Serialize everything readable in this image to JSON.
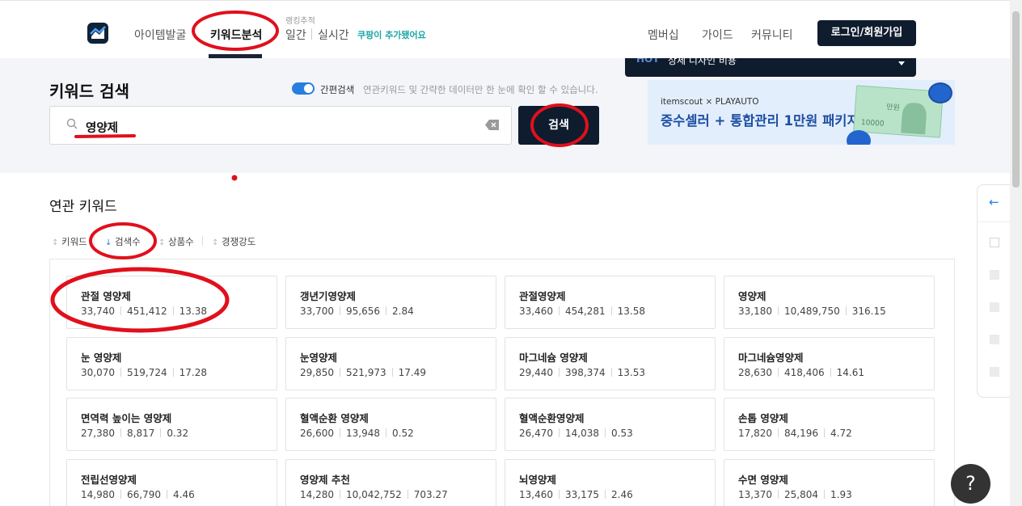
{
  "nav": {
    "items": [
      "아이템발굴",
      "키워드분석"
    ],
    "ranking_label": "랭킹추적",
    "daily": "일간",
    "realtime": "실시간",
    "coupang_badge": "쿠팡이 추가됐어요",
    "right_items": [
      "멤버십",
      "가이드",
      "커뮤니티"
    ],
    "login": "로그인/회원가입"
  },
  "hot": {
    "label": "HOT",
    "text": "상세 디자인 비용"
  },
  "search": {
    "title": "키워드 검색",
    "toggle_label": "간편검색",
    "toggle_desc": "연관키워드 및 간략한 데이터만 한 눈에 확인 할 수 있습니다.",
    "query": "영양제",
    "button": "검색"
  },
  "banner": {
    "brand": "itemscout × PLAYAUTO",
    "text": "중수셀러 + 통합관리 1만원 패키지",
    "money_amount": "만원",
    "money_number": "10000"
  },
  "related": {
    "title": "연관 키워드",
    "sort": [
      {
        "label": "키워드",
        "icon": "sort-both-icon",
        "active": false
      },
      {
        "label": "검색수",
        "icon": "sort-desc-icon",
        "active": true
      },
      {
        "label": "상품수",
        "icon": "sort-both-icon",
        "active": false
      },
      {
        "label": "경쟁강도",
        "icon": "sort-both-icon",
        "active": false
      }
    ],
    "cards": [
      {
        "name": "관절 영양제",
        "searches": "33,740",
        "products": "451,412",
        "competition": "13.38"
      },
      {
        "name": "갱년기영양제",
        "searches": "33,700",
        "products": "95,656",
        "competition": "2.84"
      },
      {
        "name": "관절영양제",
        "searches": "33,460",
        "products": "454,281",
        "competition": "13.58"
      },
      {
        "name": "영양제",
        "searches": "33,180",
        "products": "10,489,750",
        "competition": "316.15"
      },
      {
        "name": "눈 영양제",
        "searches": "30,070",
        "products": "519,724",
        "competition": "17.28"
      },
      {
        "name": "눈영양제",
        "searches": "29,850",
        "products": "521,973",
        "competition": "17.49"
      },
      {
        "name": "마그네슘 영양제",
        "searches": "29,440",
        "products": "398,374",
        "competition": "13.53"
      },
      {
        "name": "마그네슘영양제",
        "searches": "28,630",
        "products": "418,406",
        "competition": "14.61"
      },
      {
        "name": "면역력 높이는 영양제",
        "searches": "27,380",
        "products": "8,817",
        "competition": "0.32"
      },
      {
        "name": "혈액순환 영양제",
        "searches": "26,600",
        "products": "13,948",
        "competition": "0.52"
      },
      {
        "name": "혈액순환영양제",
        "searches": "26,470",
        "products": "14,038",
        "competition": "0.53"
      },
      {
        "name": "손톱 영양제",
        "searches": "17,820",
        "products": "84,196",
        "competition": "4.72"
      },
      {
        "name": "전립선영양제",
        "searches": "14,980",
        "products": "66,790",
        "competition": "4.46"
      },
      {
        "name": "영양제 추천",
        "searches": "14,280",
        "products": "10,042,752",
        "competition": "703.27"
      },
      {
        "name": "뇌영양제",
        "searches": "13,460",
        "products": "33,175",
        "competition": "2.46"
      },
      {
        "name": "수면 영양제",
        "searches": "13,370",
        "products": "25,804",
        "competition": "1.93"
      }
    ]
  },
  "help": "?",
  "colors": {
    "navy": "#0f1c2e",
    "accent": "#2a7de1",
    "annotation": "#e0101c"
  }
}
